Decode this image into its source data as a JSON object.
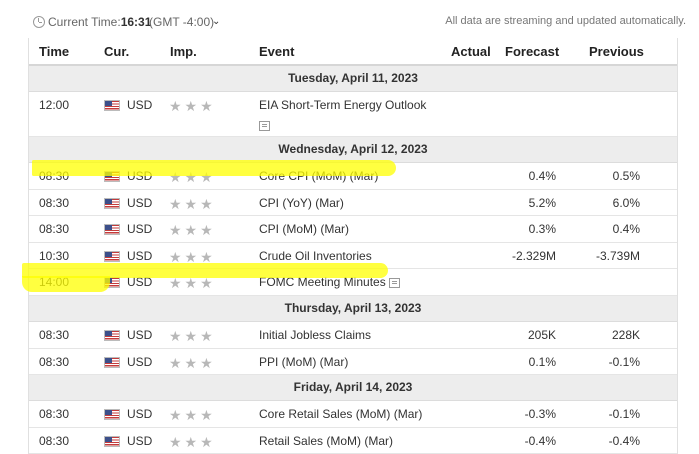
{
  "topbar": {
    "time_label": "Current Time:",
    "time_value": "16:31",
    "timezone": "(GMT -4:00)",
    "streaming_note": "All data are streaming and updated automatically."
  },
  "columns": {
    "time": "Time",
    "cur": "Cur.",
    "imp": "Imp.",
    "event": "Event",
    "actual": "Actual",
    "forecast": "Forecast",
    "previous": "Previous"
  },
  "days": [
    {
      "label": "Tuesday, April 11, 2023"
    },
    {
      "label": "Wednesday, April 12, 2023"
    },
    {
      "label": "Thursday, April 13, 2023"
    },
    {
      "label": "Friday, April 14, 2023"
    }
  ],
  "rows": [
    {
      "time": "12:00",
      "cur": "USD",
      "stars": "★★★",
      "event": "EIA Short-Term Energy Outlook",
      "forecast": "",
      "previous": ""
    },
    {
      "time": "08:30",
      "cur": "USD",
      "stars": "★★★",
      "event": "Core CPI (MoM) (Mar)",
      "forecast": "0.4%",
      "previous": "0.5%"
    },
    {
      "time": "08:30",
      "cur": "USD",
      "stars": "★★★",
      "event": "CPI (YoY) (Mar)",
      "forecast": "5.2%",
      "previous": "6.0%"
    },
    {
      "time": "08:30",
      "cur": "USD",
      "stars": "★★★",
      "event": "CPI (MoM) (Mar)",
      "forecast": "0.3%",
      "previous": "0.4%"
    },
    {
      "time": "10:30",
      "cur": "USD",
      "stars": "★★★",
      "event": "Crude Oil Inventories",
      "forecast": "-2.329M",
      "previous": "-3.739M"
    },
    {
      "time": "14:00",
      "cur": "USD",
      "stars": "★★★",
      "event": "FOMC Meeting Minutes",
      "forecast": "",
      "previous": ""
    },
    {
      "time": "08:30",
      "cur": "USD",
      "stars": "★★★",
      "event": "Initial Jobless Claims",
      "forecast": "205K",
      "previous": "228K"
    },
    {
      "time": "08:30",
      "cur": "USD",
      "stars": "★★★",
      "event": "PPI (MoM) (Mar)",
      "forecast": "0.1%",
      "previous": "-0.1%"
    },
    {
      "time": "08:30",
      "cur": "USD",
      "stars": "★★★",
      "event": "Core Retail Sales (MoM) (Mar)",
      "forecast": "-0.3%",
      "previous": "-0.1%"
    },
    {
      "time": "08:30",
      "cur": "USD",
      "stars": "★★★",
      "event": "Retail Sales (MoM) (Mar)",
      "forecast": "-0.4%",
      "previous": "-0.4%"
    }
  ],
  "highlight_color": "#ffff00",
  "icons": {
    "clock": "clock-icon",
    "caret": "chevron-down-icon",
    "flag": "us-flag-icon",
    "doc": "document-icon"
  }
}
